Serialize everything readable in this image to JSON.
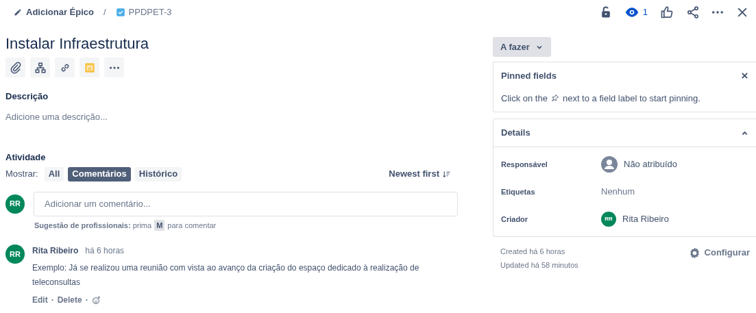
{
  "breadcrumb": {
    "epic_link": "Adicionar Épico",
    "separator": "/",
    "issue_key": "PPDPET-3"
  },
  "toolbar": {
    "watchers": "1"
  },
  "title": "Instalar Infraestrutura",
  "description": {
    "label": "Descrição",
    "placeholder": "Adicione uma descrição..."
  },
  "activity": {
    "label": "Atividade",
    "show_label": "Mostrar:",
    "filters": [
      {
        "label": "All",
        "selected": false
      },
      {
        "label": "Comentários",
        "selected": true
      },
      {
        "label": "Histórico",
        "selected": false
      }
    ],
    "sort": "Newest first",
    "comment_field": {
      "avatar": "RR",
      "placeholder": "Adicionar um comentário..."
    },
    "tip": "**Sugestão de profissionais:** prima",
    "tip_key": "M",
    "tip_end": "para comentar",
    "comments": [
      {
        "avatar": "RR",
        "author": "Rita Ribeiro",
        "time": "há 6 horas",
        "body": "Exemplo: Já se realizou uma reunião com vista ao avanço da criação do espaço dedicado à realização de teleconsultas",
        "actions": [
          "Edit",
          "Delete"
        ],
        "action_separator": "·"
      }
    ]
  },
  "status": {
    "label": "A fazer"
  },
  "pinned": {
    "title": "Pinned fields",
    "hint_before": "Click on the",
    "hint_after": "next to a field label to start pinning."
  },
  "details": {
    "title": "Details",
    "expanded": true,
    "fields": [
      {
        "label": "Responsável",
        "kind": "unassigned",
        "value": "Não atribuído"
      },
      {
        "label": "Etiquetas",
        "kind": "text",
        "value": "Nenhum"
      },
      {
        "label": "Criador",
        "kind": "user",
        "avatar": "RR",
        "value": "Rita Ribeiro"
      }
    ]
  },
  "created": "Created há 6 horas",
  "updated": "Updated há 58 minutos",
  "configure": "Configurar"
}
